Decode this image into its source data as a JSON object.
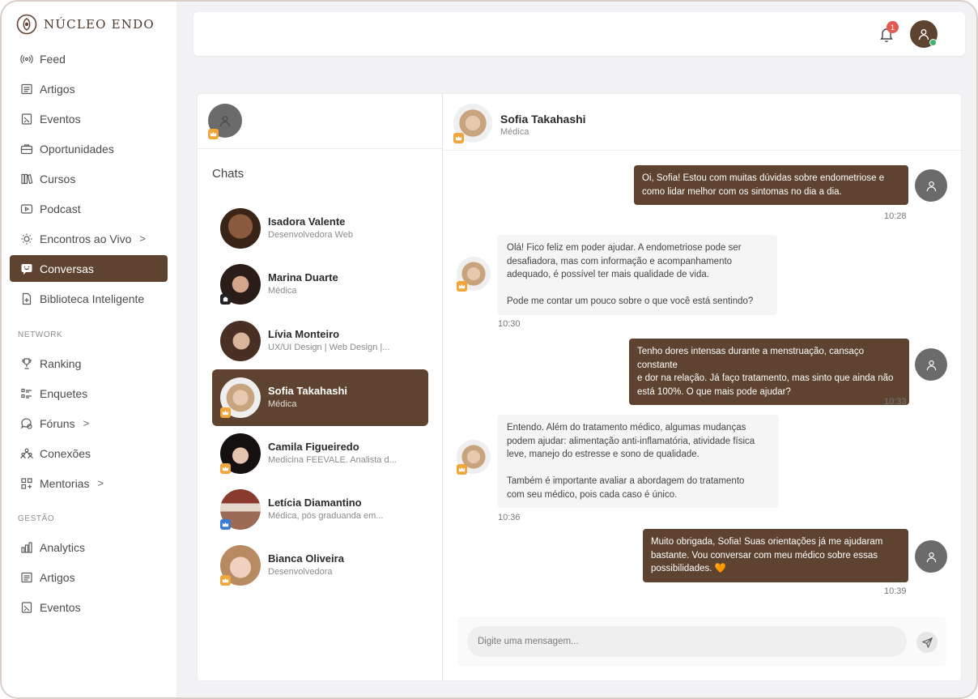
{
  "brand": {
    "name": "NÚCLEO ENDO"
  },
  "sidebar": {
    "main_items": [
      {
        "label": "Feed",
        "icon": "broadcast-icon"
      },
      {
        "label": "Artigos",
        "icon": "article-icon"
      },
      {
        "label": "Eventos",
        "icon": "calendar-icon"
      },
      {
        "label": "Oportunidades",
        "icon": "briefcase-icon"
      },
      {
        "label": "Cursos",
        "icon": "books-icon"
      },
      {
        "label": "Podcast",
        "icon": "play-icon"
      },
      {
        "label": "Encontros ao Vivo",
        "icon": "live-icon",
        "chevron": ">"
      },
      {
        "label": "Conversas",
        "icon": "chat-icon",
        "active": true
      },
      {
        "label": "Biblioteca Inteligente",
        "icon": "file-plus-icon"
      }
    ],
    "network_label": "NETWORK",
    "network_items": [
      {
        "label": "Ranking",
        "icon": "trophy-icon"
      },
      {
        "label": "Enquetes",
        "icon": "poll-icon"
      },
      {
        "label": "Fóruns",
        "icon": "forum-icon",
        "chevron": ">"
      },
      {
        "label": "Conexões",
        "icon": "people-icon"
      },
      {
        "label": "Mentorias",
        "icon": "grid-plus-icon",
        "chevron": ">"
      }
    ],
    "gestao_label": "GESTÃO",
    "gestao_items": [
      {
        "label": "Analytics",
        "icon": "bar-chart-icon"
      },
      {
        "label": "Artigos",
        "icon": "article-icon"
      },
      {
        "label": "Eventos",
        "icon": "calendar-icon"
      }
    ]
  },
  "topbar": {
    "notification_count": "1"
  },
  "chats": {
    "title": "Chats",
    "items": [
      {
        "name": "Isadora Valente",
        "sub": "Desenvolvedora Web",
        "badge": "none"
      },
      {
        "name": "Marina Duarte",
        "sub": "Médica",
        "badge": "black"
      },
      {
        "name": "Lívia Monteiro",
        "sub": "UX/UI Design | Web Design |...",
        "badge": "none"
      },
      {
        "name": "Sofia Takahashi",
        "sub": "Médica",
        "badge": "gold",
        "active": true
      },
      {
        "name": "Camila Figueiredo",
        "sub": "Medicina FEEVALE. Analista d...",
        "badge": "gold"
      },
      {
        "name": "Letícia Diamantino",
        "sub": "Médica, pós graduanda em...",
        "badge": "blue"
      },
      {
        "name": "Bianca Oliveira",
        "sub": "Desenvolvedora",
        "badge": "gold"
      }
    ]
  },
  "conversation": {
    "name": "Sofia Takahashi",
    "role": "Médica",
    "messages": [
      {
        "dir": "out",
        "lines": [
          "Oi, Sofia! Estou com muitas dúvidas sobre endometriose e",
          "como lidar melhor com os sintomas no dia a dia."
        ],
        "time": "10:28"
      },
      {
        "dir": "in",
        "lines": [
          "Olá! Fico feliz em poder ajudar. A endometriose pode ser",
          "desafiadora, mas com informação e acompanhamento",
          "adequado, é possível ter mais qualidade de vida.",
          "",
          "Pode me contar um pouco sobre o que você está sentindo?"
        ],
        "time": "10:30"
      },
      {
        "dir": "out",
        "lines": [
          "Tenho dores intensas durante a menstruação, cansaço constante",
          "e dor na relação. Já faço tratamento, mas sinto que ainda não",
          "está 100%. O que mais pode ajudar?"
        ],
        "time": "10:33"
      },
      {
        "dir": "in",
        "lines": [
          "Entendo. Além do tratamento médico, algumas mudanças",
          "podem ajudar: alimentação anti-inflamatória, atividade física",
          "leve, manejo do estresse e sono de qualidade.",
          "",
          "Também é importante avaliar a abordagem do tratamento",
          "com seu médico, pois cada caso é único."
        ],
        "time": "10:36"
      },
      {
        "dir": "out",
        "lines": [
          "Muito obrigada, Sofia! Suas orientações já me ajudaram",
          "bastante. Vou conversar com meu médico sobre essas",
          "possibilidades. 🧡"
        ],
        "time": "10:39"
      }
    ],
    "composer_placeholder": "Digite uma mensagem..."
  },
  "colors": {
    "accent": "#5e4330",
    "badge_gold": "#f0a63a",
    "notification": "#e25b52",
    "online": "#3fb36a"
  }
}
